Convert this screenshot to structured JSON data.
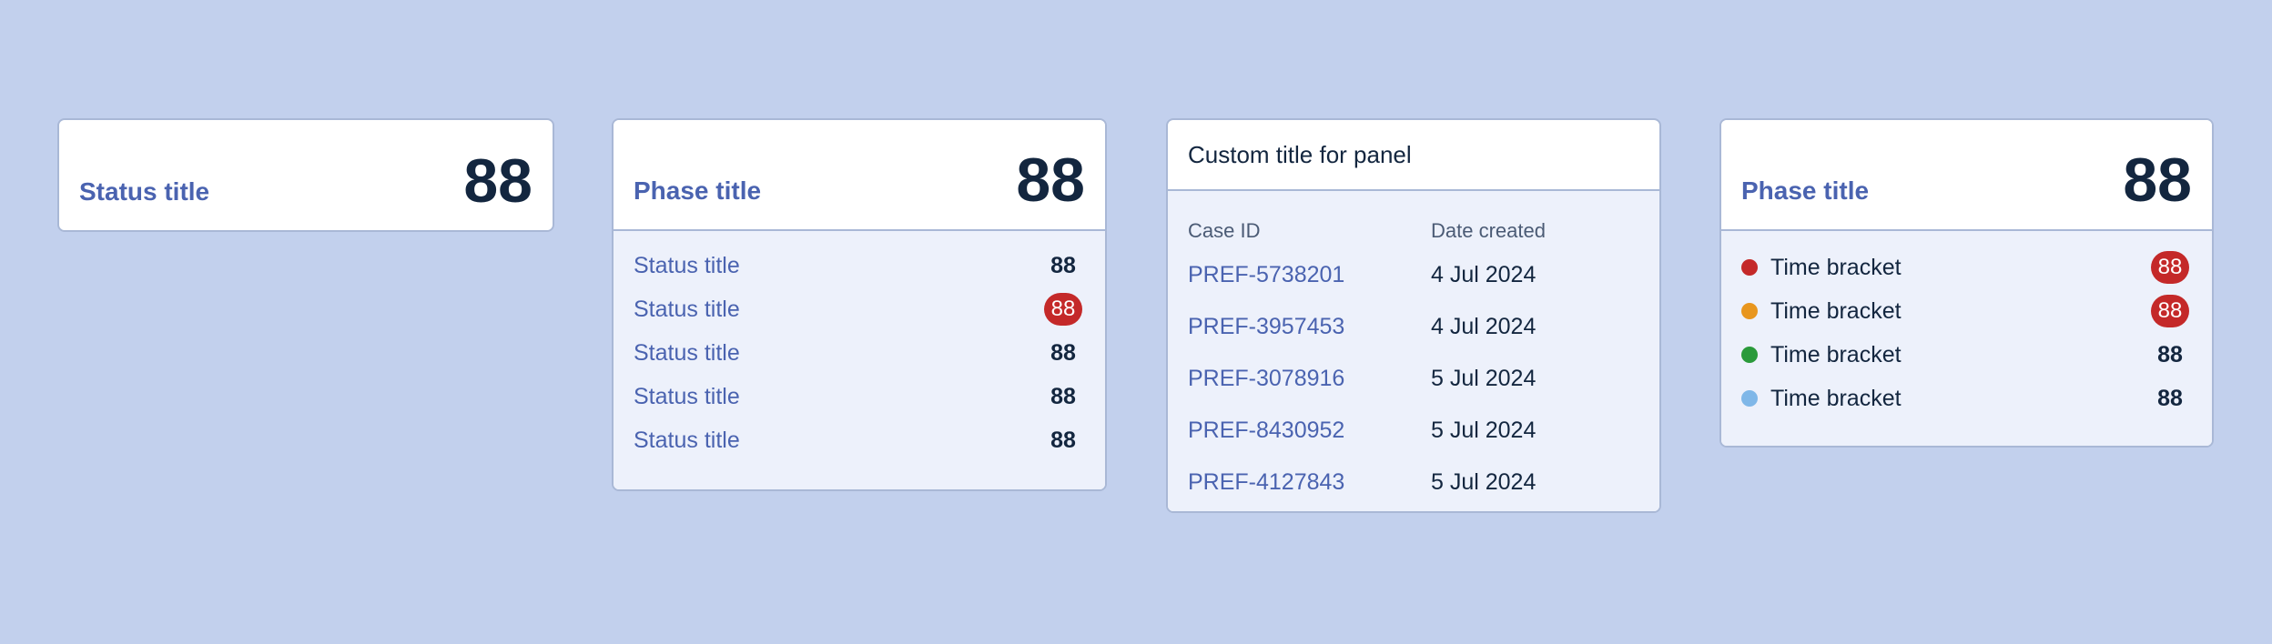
{
  "panels": {
    "status_panel": {
      "title": "Status title",
      "count": "88"
    },
    "phase_panel": {
      "title": "Phase title",
      "count": "88",
      "rows": [
        {
          "label": "Status title",
          "value": "88",
          "highlight": false
        },
        {
          "label": "Status title",
          "value": "88",
          "highlight": true
        },
        {
          "label": "Status title",
          "value": "88",
          "highlight": false
        },
        {
          "label": "Status title",
          "value": "88",
          "highlight": false
        },
        {
          "label": "Status title",
          "value": "88",
          "highlight": false
        }
      ]
    },
    "custom_panel": {
      "title": "Custom title for panel",
      "columns": [
        "Case ID",
        "Date created"
      ],
      "rows": [
        {
          "case_id": "PREF-5738201",
          "date": "4 Jul 2024"
        },
        {
          "case_id": "PREF-3957453",
          "date": "4 Jul 2024"
        },
        {
          "case_id": "PREF-3078916",
          "date": "5 Jul 2024"
        },
        {
          "case_id": "PREF-8430952",
          "date": "5 Jul 2024"
        },
        {
          "case_id": "PREF-4127843",
          "date": "5 Jul 2024"
        }
      ]
    },
    "time_panel": {
      "title": "Phase title",
      "count": "88",
      "rows": [
        {
          "label": "Time bracket",
          "value": "88",
          "dot_color": "#c42929",
          "highlight": true
        },
        {
          "label": "Time bracket",
          "value": "88",
          "dot_color": "#e8961e",
          "highlight": true
        },
        {
          "label": "Time bracket",
          "value": "88",
          "dot_color": "#2a9a3a",
          "highlight": false
        },
        {
          "label": "Time bracket",
          "value": "88",
          "dot_color": "#7fb7e8",
          "highlight": false
        }
      ]
    }
  },
  "colors": {
    "background": "#c2d0ed",
    "accent": "#4a63b0",
    "badge": "#c42929",
    "text_dark": "#13263f"
  }
}
